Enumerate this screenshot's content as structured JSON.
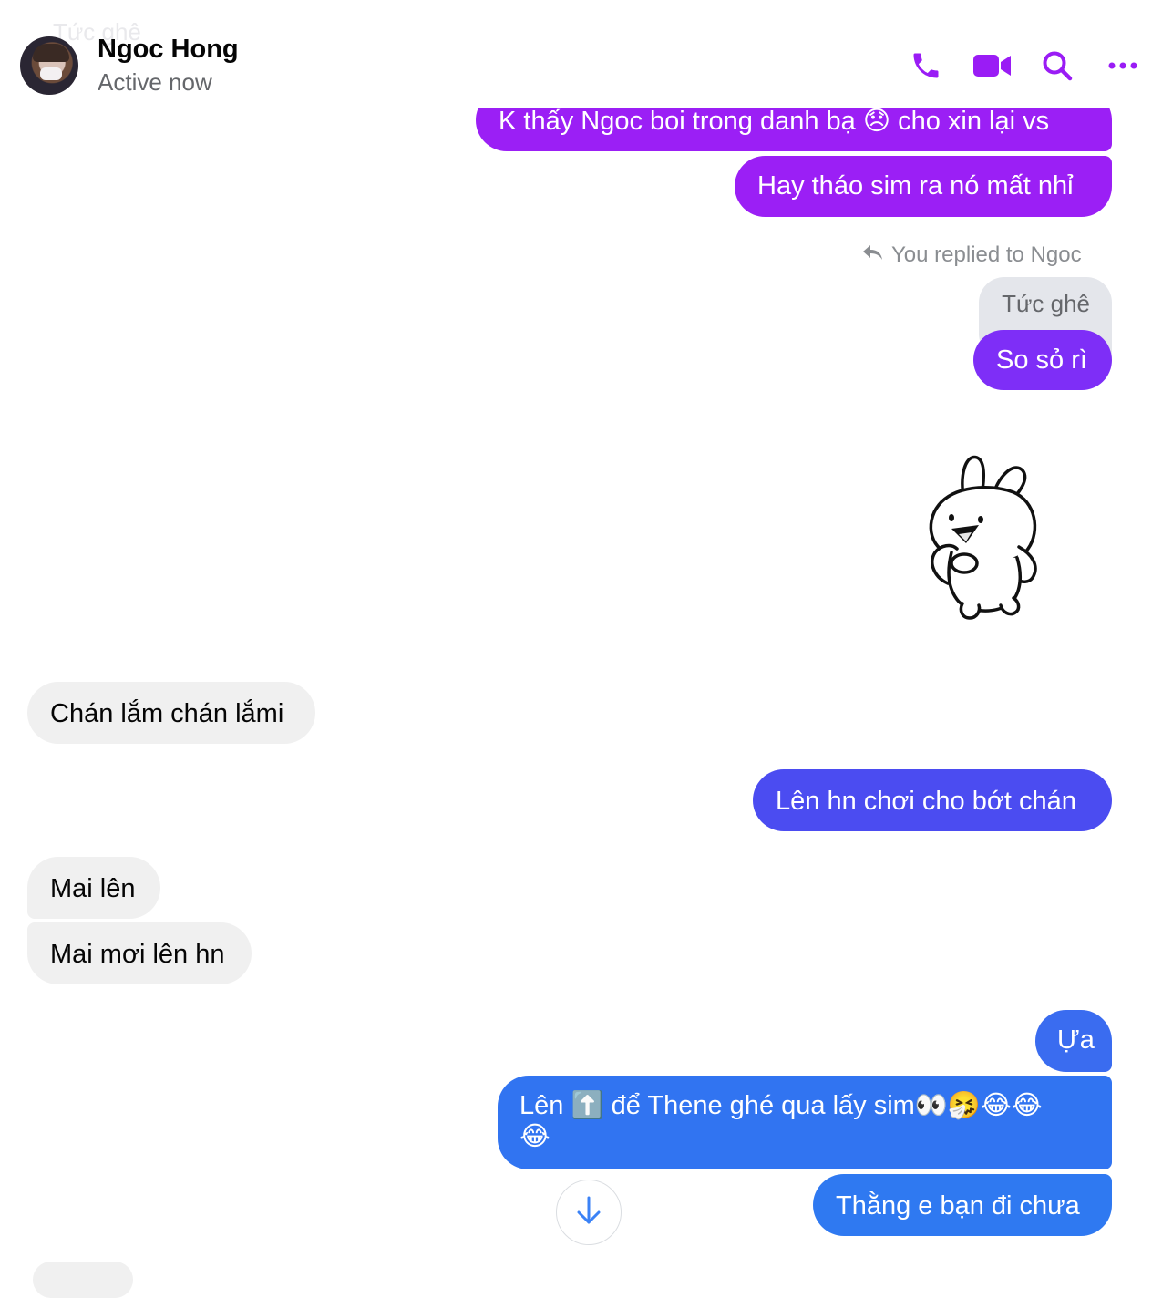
{
  "header": {
    "faded_text": "Tức ghê",
    "contact_name": "Ngoc Hong",
    "status": "Active now"
  },
  "messages": [
    {
      "id": "m1",
      "dir": "outgoing",
      "text": "K thấy Ngoc boi trong danh bạ 😞 cho xin lại vs",
      "color": "#9b1ff5"
    },
    {
      "id": "m2",
      "dir": "outgoing",
      "text": "Hay tháo sim ra nó mất nhỉ",
      "color": "#9b1ff5"
    },
    {
      "id": "m3",
      "dir": "outgoing",
      "text": "So sỏ rì",
      "color": "#7e2ef7",
      "reply_label": "You replied to Ngoc",
      "quoted_text": "Tức ghê"
    },
    {
      "id": "m4",
      "dir": "outgoing",
      "type": "sticker",
      "sticker": "bunny-sticker"
    },
    {
      "id": "m5",
      "dir": "incoming",
      "text": "Chán lắm chán lắmi"
    },
    {
      "id": "m6",
      "dir": "outgoing",
      "text": "Lên hn chơi cho bớt chán",
      "color": "#4b4cf1"
    },
    {
      "id": "m7",
      "dir": "incoming",
      "text": "Mai lên"
    },
    {
      "id": "m8",
      "dir": "incoming",
      "text": "Mai mơi lên hn"
    },
    {
      "id": "m9",
      "dir": "outgoing",
      "text": "Ựa",
      "color": "#3a6cf0"
    },
    {
      "id": "m10",
      "dir": "outgoing",
      "text_line1": "Lên ⬆️ để Thene ghé qua lấy sim👀🤧😂😂",
      "text_line2": "😂",
      "color": "#3174f1"
    },
    {
      "id": "m11",
      "dir": "outgoing",
      "text": "Thằng e bạn đi chưa",
      "color": "#2f79f1"
    }
  ],
  "icons": {
    "call": "phone-icon",
    "video": "video-camera-icon",
    "search": "search-icon",
    "more": "more-icon",
    "scroll": "arrow-down-icon"
  },
  "colors": {
    "accent": "#9a1cf5",
    "incoming_bg": "#f0f0f0",
    "scroll_arrow": "#3b82f6"
  }
}
